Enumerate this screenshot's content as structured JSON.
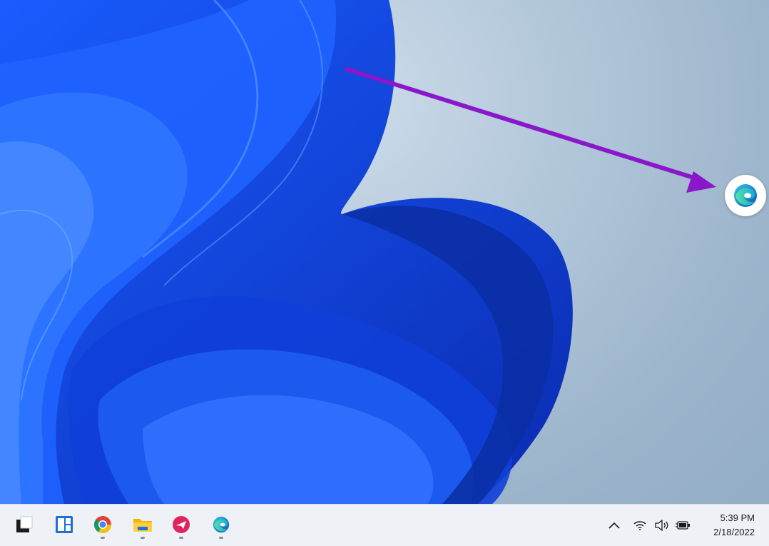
{
  "desktop": {
    "wallpaper": "windows-11-bloom",
    "overlay_icon": "edge-icon",
    "arrow_color": "#8a17c9"
  },
  "taskbar": {
    "apps": [
      {
        "name": "start-icon"
      },
      {
        "name": "widgets-icon"
      },
      {
        "name": "chrome-icon",
        "running": true
      },
      {
        "name": "file-explorer-icon",
        "running": true
      },
      {
        "name": "airmail-icon",
        "running": true
      },
      {
        "name": "edge-icon",
        "running": true
      }
    ],
    "tray": {
      "icons": [
        "chevron-up-icon",
        "wifi-icon",
        "volume-icon",
        "battery-icon"
      ]
    },
    "clock": {
      "time": "5:39 PM",
      "date": "2/18/2022"
    }
  }
}
